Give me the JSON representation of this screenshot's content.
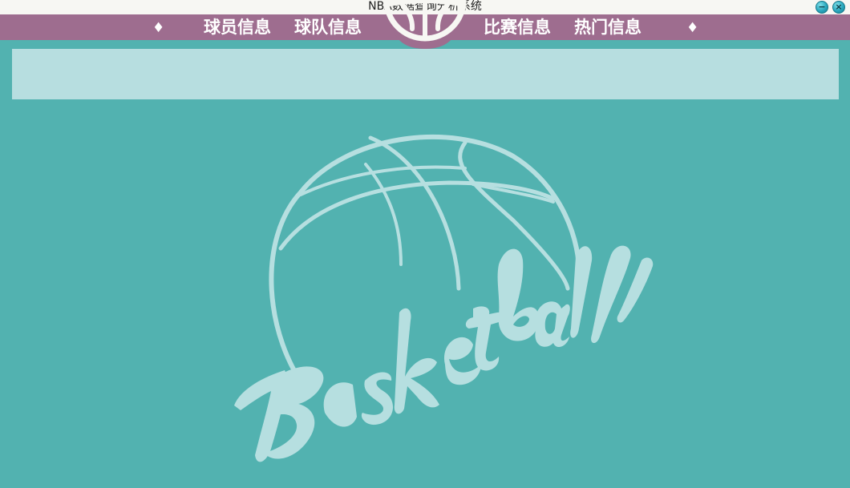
{
  "window": {
    "title": "NBA数据查询分析系统",
    "minimize_glyph": "−",
    "close_glyph": "×"
  },
  "nav": {
    "left_marker": "♦",
    "right_marker": "♦",
    "items": [
      {
        "label": "球员信息"
      },
      {
        "label": "球队信息"
      },
      {
        "label": "比赛信息"
      },
      {
        "label": "热门信息"
      }
    ]
  },
  "hero": {
    "wordmark": "Basketball"
  },
  "colors": {
    "background": "#52b2b0",
    "nav_bar": "#9e6d8f",
    "panel": "#b7dee0",
    "title_bar": "#f7f7f3"
  },
  "icons": {
    "logo": "basketball-logo-icon",
    "hero": "basketball-illustration-icon"
  }
}
